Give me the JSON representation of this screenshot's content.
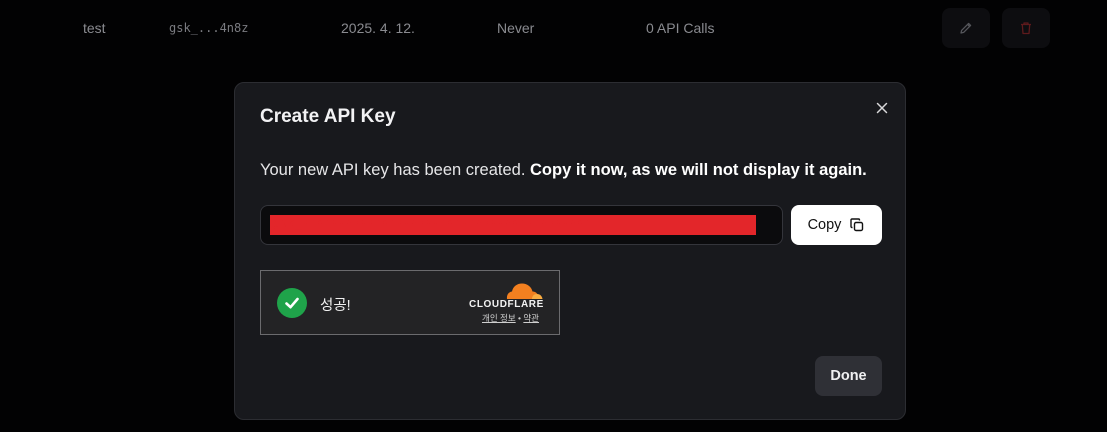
{
  "background_row": {
    "name": "test",
    "key_preview": "gsk_...4n8z",
    "created": "2025. 4. 12.",
    "last_used": "Never",
    "usage": "0 API Calls",
    "edit_icon": "pencil-icon",
    "delete_icon": "trash-icon"
  },
  "modal": {
    "title": "Create API Key",
    "message_normal": "Your new API key has been created. ",
    "message_bold": "Copy it now, as we will not display it again.",
    "api_key_value": "gsk_••••••••••••••••••••••••••••••••••••••••",
    "copy_label": "Copy",
    "copy_icon": "copy-icon",
    "close_icon": "close-icon",
    "done_label": "Done"
  },
  "captcha": {
    "status_text": "성공!",
    "brand": "CLOUDFLARE",
    "privacy_link": "개인 정보",
    "separator": " • ",
    "terms_link": "약관"
  },
  "colors": {
    "modal_bg": "#18191d",
    "redaction": "#e3262a",
    "success_green": "#1fa34a",
    "cloudflare_orange": "#f38020"
  }
}
